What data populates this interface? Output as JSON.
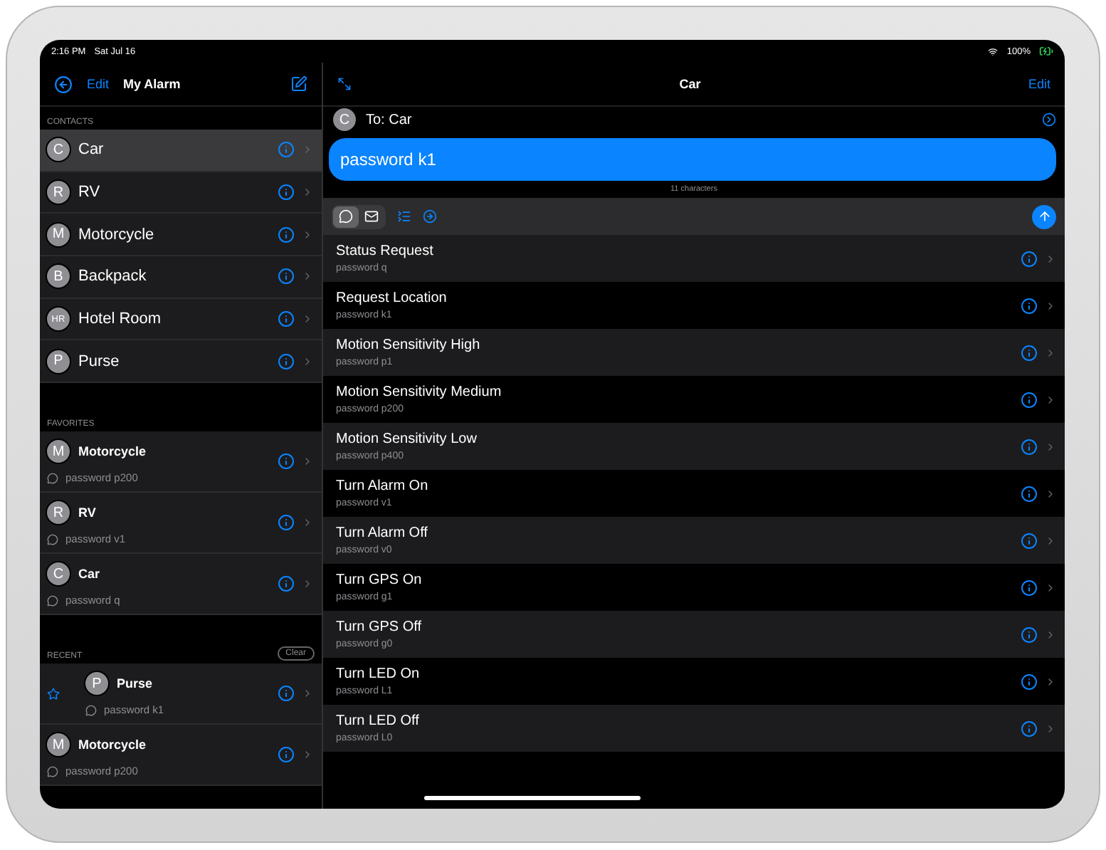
{
  "status_bar": {
    "time": "2:16 PM",
    "date": "Sat Jul 16",
    "battery": "100%"
  },
  "sidebar": {
    "edit": "Edit",
    "title": "My Alarm",
    "contacts": {
      "header": "CONTACTS",
      "items": [
        {
          "initials": "C",
          "name": "Car",
          "selected": true
        },
        {
          "initials": "R",
          "name": "RV",
          "selected": false
        },
        {
          "initials": "M",
          "name": "Motorcycle",
          "selected": false
        },
        {
          "initials": "B",
          "name": "Backpack",
          "selected": false
        },
        {
          "initials": "HR",
          "name": "Hotel Room",
          "selected": false
        },
        {
          "initials": "P",
          "name": "Purse",
          "selected": false
        }
      ]
    },
    "favorites": {
      "header": "FAVORITES",
      "items": [
        {
          "initials": "M",
          "name": "Motorcycle",
          "message": "password p200"
        },
        {
          "initials": "R",
          "name": "RV",
          "message": "password v1"
        },
        {
          "initials": "C",
          "name": "Car",
          "message": "password q"
        }
      ]
    },
    "recent": {
      "header": "RECENT",
      "clear": "Clear",
      "items": [
        {
          "initials": "P",
          "name": "Purse",
          "message": "password k1",
          "starred": true
        },
        {
          "initials": "M",
          "name": "Motorcycle",
          "message": "password p200",
          "starred": false
        }
      ]
    }
  },
  "conversation": {
    "title": "Car",
    "edit": "Edit",
    "initials": "C",
    "to": "To: Car",
    "message": "password k1",
    "char_count": "11 characters",
    "modes": [
      {
        "kind": "sms",
        "selected": true
      },
      {
        "kind": "email",
        "selected": false
      }
    ],
    "commands": [
      {
        "name": "Status Request",
        "code": "password q"
      },
      {
        "name": "Request Location",
        "code": "password k1"
      },
      {
        "name": "Motion Sensitivity High",
        "code": "password p1"
      },
      {
        "name": "Motion Sensitivity Medium",
        "code": "password p200"
      },
      {
        "name": "Motion Sensitivity Low",
        "code": "password p400"
      },
      {
        "name": "Turn Alarm On",
        "code": "password v1"
      },
      {
        "name": "Turn Alarm Off",
        "code": "password v0"
      },
      {
        "name": "Turn GPS On",
        "code": "password g1"
      },
      {
        "name": "Turn GPS Off",
        "code": "password g0"
      },
      {
        "name": "Turn LED On",
        "code": "password L1"
      },
      {
        "name": "Turn LED Off",
        "code": "password L0"
      }
    ]
  }
}
